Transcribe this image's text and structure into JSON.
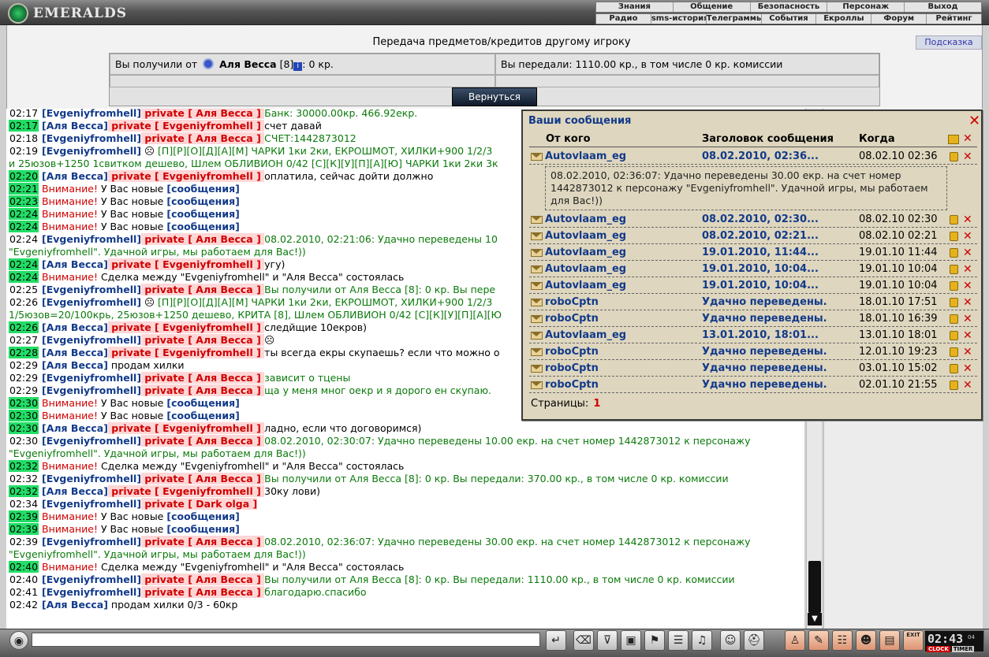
{
  "app": {
    "logo_text": "EMERALDS"
  },
  "topmenu": {
    "row1": [
      "Знания",
      "Общение",
      "Безопасность",
      "Персонаж",
      "Выход"
    ],
    "row2": [
      "Радио",
      "sms-история",
      "Телеграммы",
      "События",
      "Екроллы",
      "Форум",
      "Рейтинг"
    ]
  },
  "transfer": {
    "title": "Передача предметов/кредитов другому игроку",
    "hint": "Подсказка",
    "received_prefix": "Вы получили от",
    "received_name": "Аля Весса",
    "received_level": "[8]",
    "received_amount": ": 0 кр.",
    "sent": "Вы передали: 1110.00 кр., в том числе 0 кр. комиссии",
    "back": "Вернуться"
  },
  "chat": [
    {
      "time": "02:17",
      "hl": false,
      "parts": [
        {
          "c": "nm",
          "t": "[Evgeniyfromhell]"
        },
        {
          "c": "pv",
          "t": " private [ Аля Весса ] "
        },
        {
          "c": "gr",
          "t": "Банк: 30000.00кр. 466.92екр."
        }
      ]
    },
    {
      "time": "02:17",
      "hl": true,
      "parts": [
        {
          "c": "nm",
          "t": "[Аля Весса]"
        },
        {
          "c": "pv",
          "t": " private [ Evgeniyfromhell ] "
        },
        {
          "c": "bk",
          "t": "счет давай"
        }
      ]
    },
    {
      "time": "02:18",
      "hl": false,
      "parts": [
        {
          "c": "nm",
          "t": "[Evgeniyfromhell]"
        },
        {
          "c": "pv",
          "t": " private [ Аля Весса ] "
        },
        {
          "c": "gr",
          "t": "СЧЕТ:1442873012"
        }
      ]
    },
    {
      "time": "02:19",
      "hl": false,
      "parts": [
        {
          "c": "nm",
          "t": "[Evgeniyfromhell]"
        },
        {
          "c": "bk",
          "t": " ☹ "
        },
        {
          "c": "gr",
          "t": "[П][Р][О][Д][А][М] ЧАРКИ 1ки 2ки, ЕКРОШМОТ, ХИЛКИ+900 1/2/3"
        }
      ]
    },
    {
      "time": "",
      "hl": false,
      "parts": [
        {
          "c": "gr",
          "t": "и 25юзов+1250 1свитком дешево, Шлем ОБЛИВИОН 0/42 [С][К][У][П][А][Ю] ЧАРКИ 1ки 2ки 3к"
        }
      ]
    },
    {
      "time": "02:20",
      "hl": true,
      "parts": [
        {
          "c": "nm",
          "t": "[Аля Весса]"
        },
        {
          "c": "pv",
          "t": " private [ Evgeniyfromhell ] "
        },
        {
          "c": "bk",
          "t": "оплатила, сейчас дойти должно"
        }
      ]
    },
    {
      "time": "02:21",
      "hl": true,
      "parts": [
        {
          "c": "warn",
          "t": "Внимание!"
        },
        {
          "c": "bk",
          "t": " У Вас новые "
        },
        {
          "c": "ms",
          "t": "[сообщения]"
        }
      ]
    },
    {
      "time": "02:23",
      "hl": true,
      "parts": [
        {
          "c": "warn",
          "t": "Внимание!"
        },
        {
          "c": "bk",
          "t": " У Вас новые "
        },
        {
          "c": "ms",
          "t": "[сообщения]"
        }
      ]
    },
    {
      "time": "02:24",
      "hl": true,
      "parts": [
        {
          "c": "warn",
          "t": "Внимание!"
        },
        {
          "c": "bk",
          "t": " У Вас новые "
        },
        {
          "c": "ms",
          "t": "[сообщения]"
        }
      ]
    },
    {
      "time": "02:24",
      "hl": true,
      "parts": [
        {
          "c": "warn",
          "t": "Внимание!"
        },
        {
          "c": "bk",
          "t": " У Вас новые "
        },
        {
          "c": "ms",
          "t": "[сообщения]"
        }
      ]
    },
    {
      "time": "02:24",
      "hl": false,
      "parts": [
        {
          "c": "nm",
          "t": "[Evgeniyfromhell]"
        },
        {
          "c": "pv",
          "t": " private [ Аля Весса ] "
        },
        {
          "c": "gr",
          "t": "08.02.2010, 02:21:06: Удачно переведены 10"
        }
      ]
    },
    {
      "time": "",
      "hl": false,
      "parts": [
        {
          "c": "gr",
          "t": "\"Evgeniyfromhell\". Удачной игры, мы работаем для Вас!))"
        }
      ]
    },
    {
      "time": "02:24",
      "hl": true,
      "parts": [
        {
          "c": "nm",
          "t": "[Аля Весса]"
        },
        {
          "c": "pv",
          "t": " private [ Evgeniyfromhell ] "
        },
        {
          "c": "bk",
          "t": "угу)"
        }
      ]
    },
    {
      "time": "02:24",
      "hl": true,
      "parts": [
        {
          "c": "warn",
          "t": "Внимание!"
        },
        {
          "c": "bk",
          "t": " Сделка между \"Evgeniyfromhell\" и \"Аля Весса\" состоялась"
        }
      ]
    },
    {
      "time": "02:25",
      "hl": false,
      "parts": [
        {
          "c": "nm",
          "t": "[Evgeniyfromhell]"
        },
        {
          "c": "pv",
          "t": " private [ Аля Весса ] "
        },
        {
          "c": "gr",
          "t": "Вы получили от Аля Весса [8]: 0 кр. Вы пере"
        }
      ]
    },
    {
      "time": "02:26",
      "hl": false,
      "parts": [
        {
          "c": "nm",
          "t": "[Evgeniyfromhell]"
        },
        {
          "c": "bk",
          "t": " ☹ "
        },
        {
          "c": "gr",
          "t": "[П][Р][О][Д][А][М] ЧАРКИ 1ки 2ки, ЕКРОШМОТ, ХИЛКИ+900 1/2/3"
        }
      ]
    },
    {
      "time": "",
      "hl": false,
      "parts": [
        {
          "c": "gr",
          "t": "1/5юзов=20/100крь, 25юзов+1250 дешево, КРИТА [8], Шлем ОБЛИВИОН 0/42 [С][К][У][П][А][Ю"
        }
      ]
    },
    {
      "time": "02:26",
      "hl": true,
      "parts": [
        {
          "c": "nm",
          "t": "[Аля Весса]"
        },
        {
          "c": "pv",
          "t": " private [ Evgeniyfromhell ] "
        },
        {
          "c": "bk",
          "t": "следйщие 10екров)"
        }
      ]
    },
    {
      "time": "02:27",
      "hl": false,
      "parts": [
        {
          "c": "nm",
          "t": "[Evgeniyfromhell]"
        },
        {
          "c": "pv",
          "t": " private [ Аля Весса ] "
        },
        {
          "c": "bk",
          "t": "☹"
        }
      ]
    },
    {
      "time": "02:28",
      "hl": true,
      "parts": [
        {
          "c": "nm",
          "t": "[Аля Весса]"
        },
        {
          "c": "pv",
          "t": " private [ Evgeniyfromhell ] "
        },
        {
          "c": "bk",
          "t": "ты всегда екры скупаешь? если что можно о"
        }
      ]
    },
    {
      "time": "02:29",
      "hl": false,
      "parts": [
        {
          "c": "nm",
          "t": "[Аля Весса]"
        },
        {
          "c": "bk",
          "t": " продам хилки"
        }
      ]
    },
    {
      "time": "02:29",
      "hl": false,
      "parts": [
        {
          "c": "nm",
          "t": "[Evgeniyfromhell]"
        },
        {
          "c": "pv",
          "t": " private [ Аля Весса ] "
        },
        {
          "c": "gr",
          "t": "зависит о тцены"
        }
      ]
    },
    {
      "time": "02:29",
      "hl": false,
      "parts": [
        {
          "c": "nm",
          "t": "[Evgeniyfromhell]"
        },
        {
          "c": "pv",
          "t": " private [ Аля Весса ] "
        },
        {
          "c": "gr",
          "t": "ща у меня мног оекр и я дорого ен скупаю."
        }
      ]
    },
    {
      "time": "02:30",
      "hl": true,
      "parts": [
        {
          "c": "warn",
          "t": "Внимание!"
        },
        {
          "c": "bk",
          "t": " У Вас новые "
        },
        {
          "c": "ms",
          "t": "[сообщения]"
        }
      ]
    },
    {
      "time": "02:30",
      "hl": true,
      "parts": [
        {
          "c": "warn",
          "t": "Внимание!"
        },
        {
          "c": "bk",
          "t": " У Вас новые "
        },
        {
          "c": "ms",
          "t": "[сообщения]"
        }
      ]
    },
    {
      "time": "02:30",
      "hl": true,
      "parts": [
        {
          "c": "nm",
          "t": "[Аля Весса]"
        },
        {
          "c": "pv",
          "t": " private [ Evgeniyfromhell ] "
        },
        {
          "c": "bk",
          "t": "ладно, если что договоримся)"
        }
      ]
    },
    {
      "time": "02:30",
      "hl": false,
      "parts": [
        {
          "c": "nm",
          "t": "[Evgeniyfromhell]"
        },
        {
          "c": "pv",
          "t": " private [ Аля Весса ] "
        },
        {
          "c": "gr",
          "t": "08.02.2010, 02:30:07: Удачно переведены 10.00 екр. на счет номер 1442873012 к персонажу"
        }
      ]
    },
    {
      "time": "",
      "hl": false,
      "parts": [
        {
          "c": "gr",
          "t": "\"Evgeniyfromhell\". Удачной игры, мы работаем для Вас!))"
        }
      ]
    },
    {
      "time": "02:32",
      "hl": true,
      "parts": [
        {
          "c": "warn",
          "t": "Внимание!"
        },
        {
          "c": "bk",
          "t": " Сделка между \"Evgeniyfromhell\" и \"Аля Весса\" состоялась"
        }
      ]
    },
    {
      "time": "02:32",
      "hl": false,
      "parts": [
        {
          "c": "nm",
          "t": "[Evgeniyfromhell]"
        },
        {
          "c": "pv",
          "t": " private [ Аля Весса ] "
        },
        {
          "c": "gr",
          "t": "Вы получили от Аля Весса [8]: 0 кр. Вы передали: 370.00 кр., в том числе 0 кр. комиссии"
        }
      ]
    },
    {
      "time": "02:32",
      "hl": true,
      "parts": [
        {
          "c": "nm",
          "t": "[Аля Весса]"
        },
        {
          "c": "pv",
          "t": " private [ Evgeniyfromhell ] "
        },
        {
          "c": "bk",
          "t": "30ку лови)"
        }
      ]
    },
    {
      "time": "02:34",
      "hl": false,
      "parts": [
        {
          "c": "nm",
          "t": "[Evgeniyfromhell]"
        },
        {
          "c": "pv",
          "t": " private [ Dark olga ]"
        }
      ]
    },
    {
      "time": "02:39",
      "hl": true,
      "parts": [
        {
          "c": "warn",
          "t": "Внимание!"
        },
        {
          "c": "bk",
          "t": " У Вас новые "
        },
        {
          "c": "ms",
          "t": "[сообщения]"
        }
      ]
    },
    {
      "time": "02:39",
      "hl": true,
      "parts": [
        {
          "c": "warn",
          "t": "Внимание!"
        },
        {
          "c": "bk",
          "t": " У Вас новые "
        },
        {
          "c": "ms",
          "t": "[сообщения]"
        }
      ]
    },
    {
      "time": "02:39",
      "hl": false,
      "parts": [
        {
          "c": "nm",
          "t": "[Evgeniyfromhell]"
        },
        {
          "c": "pv",
          "t": " private [ Аля Весса ] "
        },
        {
          "c": "gr",
          "t": "08.02.2010, 02:36:07: Удачно переведены 30.00 екр. на счет номер 1442873012 к персонажу"
        }
      ]
    },
    {
      "time": "",
      "hl": false,
      "parts": [
        {
          "c": "gr",
          "t": "\"Evgeniyfromhell\". Удачной игры, мы работаем для Вас!))"
        }
      ]
    },
    {
      "time": "02:40",
      "hl": true,
      "parts": [
        {
          "c": "warn",
          "t": "Внимание!"
        },
        {
          "c": "bk",
          "t": " Сделка между \"Evgeniyfromhell\" и \"Аля Весса\" состоялась"
        }
      ]
    },
    {
      "time": "02:40",
      "hl": false,
      "parts": [
        {
          "c": "nm",
          "t": "[Evgeniyfromhell]"
        },
        {
          "c": "pv",
          "t": " private [ Аля Весса ] "
        },
        {
          "c": "gr",
          "t": "Вы получили от Аля Весса [8]: 0 кр. Вы передали: 1110.00 кр., в том числе 0 кр. комиссии"
        }
      ]
    },
    {
      "time": "02:41",
      "hl": false,
      "parts": [
        {
          "c": "nm",
          "t": "[Evgeniyfromhell]"
        },
        {
          "c": "pv",
          "t": " private [ Аля Весса ] "
        },
        {
          "c": "gr",
          "t": "благодарю.спасибо"
        }
      ]
    },
    {
      "time": "02:42",
      "hl": false,
      "parts": [
        {
          "c": "nm",
          "t": "[Аля Весса]"
        },
        {
          "c": "bk",
          "t": " продам хилки 0/3 - 60кр"
        }
      ]
    }
  ],
  "messages": {
    "title": "Ваши сообщения",
    "col_from": "От кого",
    "col_subject": "Заголовок сообщения",
    "col_when": "Когда",
    "expanded_text": "08.02.2010, 02:36:07: Удачно переведены 30.00 екр. на счет номер 1442873012 к персонажу \"Evgeniyfromhell\". Удачной игры, мы работаем для Вас!))",
    "pages_label": "Страницы:",
    "pages_current": "1",
    "rows": [
      {
        "from": "Autovlaam_eg",
        "subject": "08.02.2010, 02:36...",
        "when": "08.02.10 02:36"
      },
      {
        "from": "Autovlaam_eg",
        "subject": "08.02.2010, 02:30...",
        "when": "08.02.10 02:30"
      },
      {
        "from": "Autovlaam_eg",
        "subject": "08.02.2010, 02:21...",
        "when": "08.02.10 02:21"
      },
      {
        "from": "Autovlaam_eg",
        "subject": "19.01.2010, 11:44...",
        "when": "19.01.10 11:44"
      },
      {
        "from": "Autovlaam_eg",
        "subject": "19.01.2010, 10:04...",
        "when": "19.01.10 10:04"
      },
      {
        "from": "Autovlaam_eg",
        "subject": "19.01.2010, 10:04...",
        "when": "19.01.10 10:04"
      },
      {
        "from": "roboCptn",
        "subject": "Удачно переведены...",
        "when": "18.01.10 17:51"
      },
      {
        "from": "roboCptn",
        "subject": "Удачно переведены...",
        "when": "18.01.10 16:39"
      },
      {
        "from": "Autovlaam_eg",
        "subject": "13.01.2010, 18:01...",
        "when": "13.01.10 18:01"
      },
      {
        "from": "roboCptn",
        "subject": "Удачно переведены...",
        "when": "12.01.10 19:23"
      },
      {
        "from": "roboCptn",
        "subject": "Удачно переведены...",
        "when": "03.01.10 15:02"
      },
      {
        "from": "roboCptn",
        "subject": "Удачно переведены...",
        "when": "02.01.10 21:55"
      }
    ]
  },
  "clock": {
    "time": "02:43",
    "sub": "04",
    "tab1": "CLOCK",
    "tab2": "TIMER"
  },
  "bottom_icons": [
    "enter-icon",
    "eraser-icon",
    "filter-icon",
    "save-icon",
    "run-icon",
    "smile-list-icon",
    "music-icon",
    "smile-icon",
    "helmet-icon",
    "person-icon",
    "scroll-icon",
    "group-icon",
    "mask-icon",
    "bag-icon",
    "exit-icon"
  ],
  "bottom_exit_label": "EXIT"
}
